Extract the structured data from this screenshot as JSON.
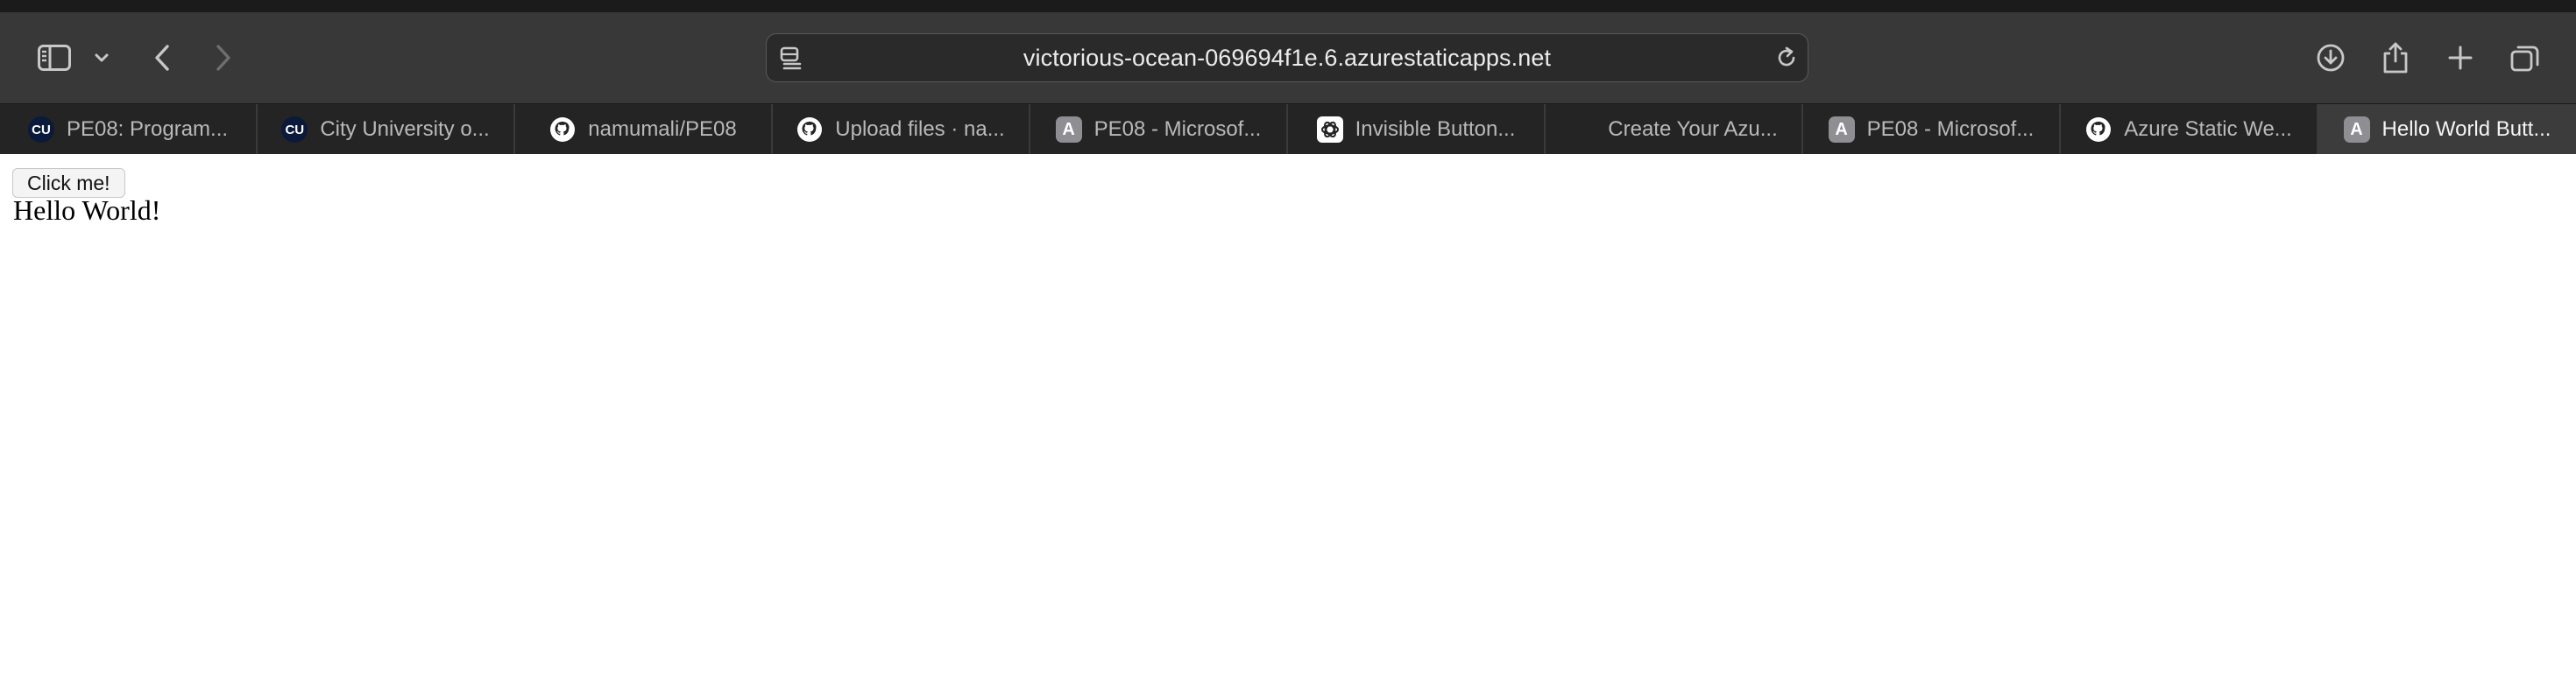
{
  "browser": {
    "address_url": "victorious-ocean-069694f1e.6.azurestaticapps.net",
    "tabs": [
      {
        "label": "PE08: Program...",
        "icon": "city-university-icon",
        "active": false
      },
      {
        "label": "City University o...",
        "icon": "city-university-icon",
        "active": false
      },
      {
        "label": "namumali/PE08",
        "icon": "github-icon",
        "active": false
      },
      {
        "label": "Upload files · na...",
        "icon": "github-icon",
        "active": false
      },
      {
        "label": "PE08 - Microsof...",
        "icon": "letter-a-icon",
        "active": false
      },
      {
        "label": "Invisible Button...",
        "icon": "openai-icon",
        "active": false
      },
      {
        "label": "Create Your Azu...",
        "icon": "microsoft-icon",
        "active": false
      },
      {
        "label": "PE08 - Microsof...",
        "icon": "letter-a-icon",
        "active": false
      },
      {
        "label": "Azure Static We...",
        "icon": "github-icon",
        "active": false
      },
      {
        "label": "Hello World Butt...",
        "icon": "letter-a-icon",
        "active": true
      }
    ],
    "favicon_text": {
      "cu": "CU",
      "a": "A"
    }
  },
  "page": {
    "button_label": "Click me!",
    "heading": "Hello World!"
  }
}
